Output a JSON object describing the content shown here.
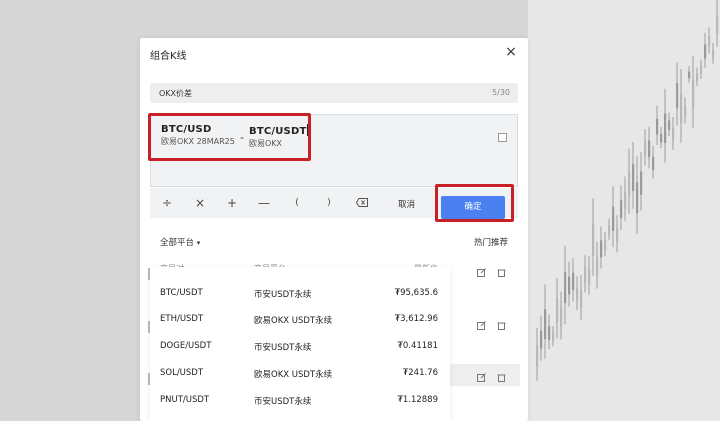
{
  "dialog": {
    "title": "组合K线",
    "close_label": "×",
    "name_field": {
      "value": "OKX价差",
      "counter": "5/30"
    },
    "formula": {
      "operand_a": {
        "symbol": "BTC/USD",
        "desc": "欧易OKX 28MAR25"
      },
      "operator": "-",
      "operand_b": {
        "symbol": "BTC/USDT",
        "desc": "欧易OKX"
      },
      "checkbox_checked": false
    },
    "toolbar": {
      "divide": "÷",
      "multiply": "×",
      "plus": "+",
      "minus": "—",
      "paren_open": "(",
      "paren_close": ")",
      "cancel": "取消",
      "confirm": "确定"
    },
    "filter": {
      "platform": "全部平台",
      "hot": "热门推荐"
    },
    "table": {
      "headers": [
        "交易对",
        "交易平台",
        "最新价"
      ],
      "rows": [
        {
          "pair": "BTC/USDT",
          "platform": "币安USDT永续",
          "price": "₮95,635.6"
        },
        {
          "pair": "ETH/USDT",
          "platform": "欧易OKX USDT永续",
          "price": "₮3,612.96"
        },
        {
          "pair": "DOGE/USDT",
          "platform": "币安USDT永续",
          "price": "₮0.41181"
        },
        {
          "pair": "SOL/USDT",
          "platform": "欧易OKX USDT永续",
          "price": "₮241.76"
        },
        {
          "pair": "PNUT/USDT",
          "platform": "币安USDT永续",
          "price": "₮1.12889"
        }
      ]
    }
  },
  "colors": {
    "accent": "#4b80f0",
    "highlight": "#c72127"
  },
  "icons": {
    "close": "close-icon",
    "backspace": "backspace-icon",
    "chevron": "chevron-down-icon",
    "edit": "edit-icon",
    "delete": "trash-icon"
  }
}
